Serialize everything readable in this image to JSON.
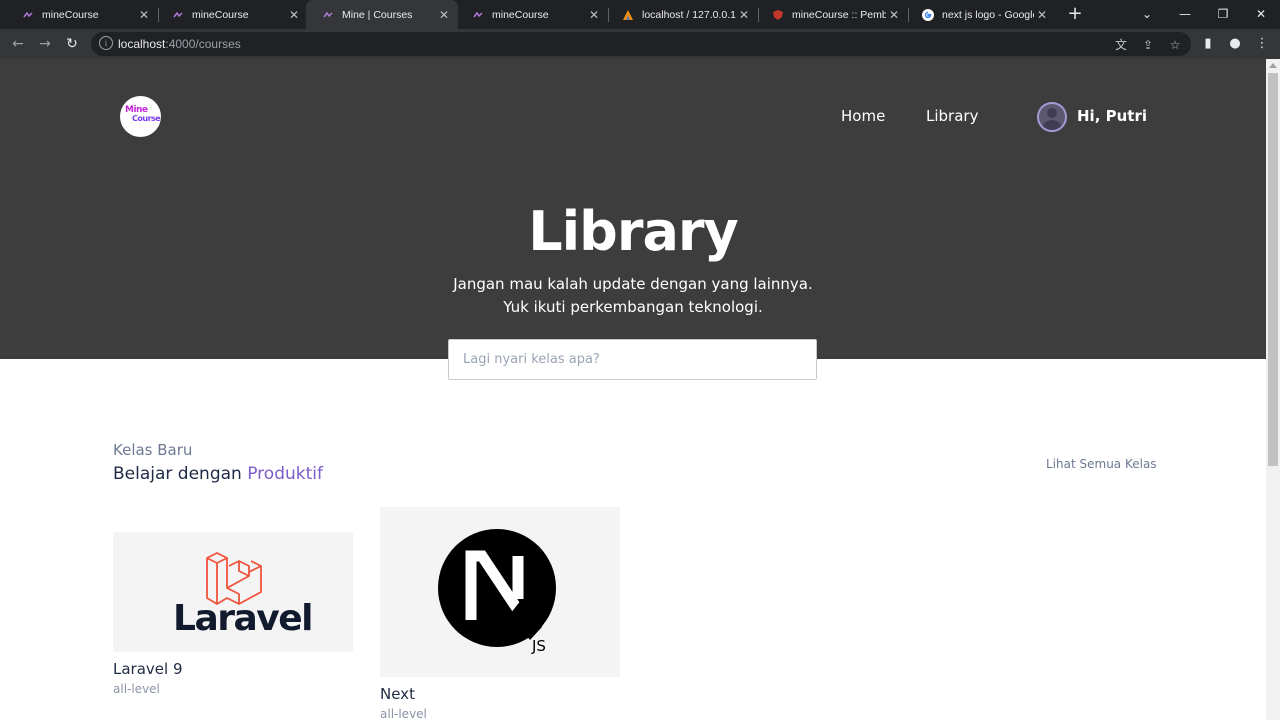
{
  "browser": {
    "tabs": [
      {
        "title": "mineCourse",
        "active": false
      },
      {
        "title": "mineCourse",
        "active": false
      },
      {
        "title": "Mine | Courses",
        "active": true
      },
      {
        "title": "mineCourse",
        "active": false
      },
      {
        "title": "localhost / 127.0.0.1 /",
        "active": false
      },
      {
        "title": "mineCourse :: Pembel",
        "active": false
      },
      {
        "title": "next js logo - Google",
        "active": false
      }
    ],
    "address": {
      "host": "localhost",
      "path": ":4000/courses"
    }
  },
  "header": {
    "logo_line1": "Mine",
    "logo_line2": "Course",
    "nav": {
      "home": "Home",
      "library": "Library"
    },
    "greeting": "Hi, Putri"
  },
  "hero": {
    "title": "Library",
    "subtitle_line1": "Jangan mau kalah update dengan yang lainnya.",
    "subtitle_line2": "Yuk ikuti perkembangan teknologi.",
    "search_placeholder": "Lagi nyari kelas apa?"
  },
  "section": {
    "kicker": "Kelas Baru",
    "title_prefix": "Belajar dengan ",
    "title_accent": "Produktif",
    "see_all": "Lihat Semua Kelas"
  },
  "courses": [
    {
      "name": "Laravel 9",
      "level": "all-level",
      "logo_text": "Laravel"
    },
    {
      "name": "Next",
      "level": "all-level",
      "logo_text": "JS"
    }
  ],
  "colors": {
    "hero_bg": "#3d3d3d",
    "accent": "#7b5cc9",
    "laravel_red": "#f0533d"
  }
}
